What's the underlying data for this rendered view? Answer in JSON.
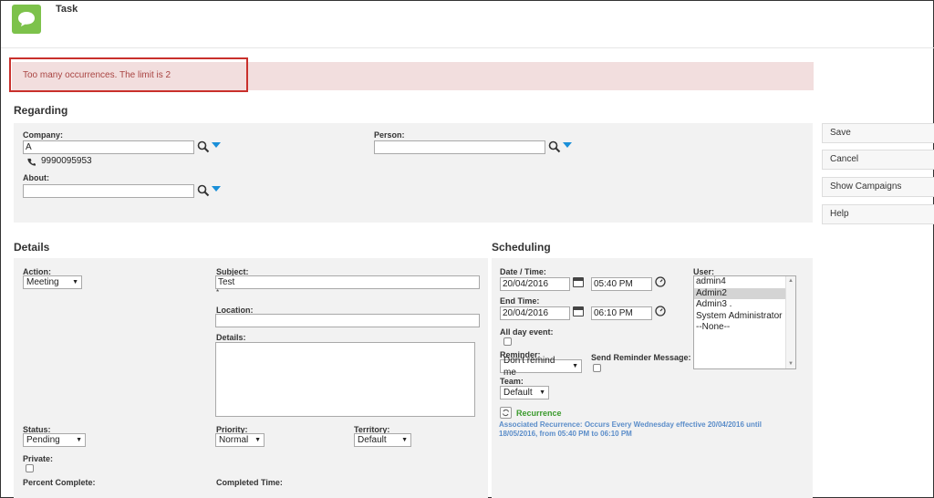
{
  "header": {
    "title": "Task"
  },
  "alert": {
    "message": "Too many occurrences. The limit is 2"
  },
  "regarding": {
    "title": "Regarding",
    "company_label": "Company:",
    "company_value": "A",
    "phone": "9990095953",
    "person_label": "Person:",
    "person_value": "",
    "about_label": "About:",
    "about_value": ""
  },
  "buttons": {
    "save": "Save",
    "cancel": "Cancel",
    "show_campaigns": "Show Campaigns",
    "help": "Help"
  },
  "details": {
    "title": "Details",
    "action_label": "Action:",
    "action_value": "Meeting",
    "subject_label": "Subject:",
    "subject_value": "Test",
    "required_mark": "*",
    "location_label": "Location:",
    "location_value": "",
    "details_label": "Details:",
    "details_value": "",
    "status_label": "Status:",
    "status_value": "Pending",
    "priority_label": "Priority:",
    "priority_value": "Normal",
    "territory_label": "Territory:",
    "territory_value": "Default",
    "private_label": "Private:",
    "percent_label": "Percent Complete:",
    "completed_label": "Completed Time:"
  },
  "scheduling": {
    "title": "Scheduling",
    "datetime_label": "Date / Time:",
    "date_value": "20/04/2016",
    "time_value": "05:40 PM",
    "endtime_label": "End Time:",
    "end_date_value": "20/04/2016",
    "end_time_value": "06:10 PM",
    "allday_label": "All day event:",
    "reminder_label": "Reminder:",
    "reminder_value": "Don't remind me",
    "send_reminder_label": "Send Reminder Message:",
    "team_label": "Team:",
    "team_value": "Default",
    "user_label": "User:",
    "users": [
      "admin4",
      "Admin2",
      "Admin3 .",
      "System Administrator",
      "--None--"
    ],
    "selected_user": "Admin2",
    "recurrence_label": "Recurrence",
    "associated_recurrence": "Associated Recurrence: Occurs Every Wednesday effective 20/04/2016 until 18/05/2016, from 05:40 PM to 06:10 PM"
  }
}
